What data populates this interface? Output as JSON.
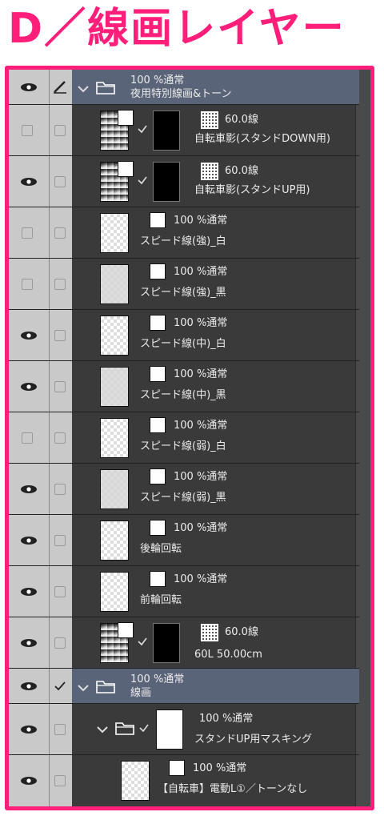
{
  "title": "D／線画レイヤー",
  "layers": [
    {
      "name": "夜用特別線画&トーン",
      "mode": "100 %通常"
    },
    {
      "name": "自転車影(スタンドDOWN用)",
      "mode": "60.0線"
    },
    {
      "name": "自転車影(スタンドUP用)",
      "mode": "60.0線"
    },
    {
      "name": "スピード線(強)_白",
      "mode": "100 %通常"
    },
    {
      "name": "スピード線(強)_黒",
      "mode": "100 %通常"
    },
    {
      "name": "スピード線(中)_白",
      "mode": "100 %通常"
    },
    {
      "name": "スピード線(中)_黒",
      "mode": "100 %通常"
    },
    {
      "name": "スピード線(弱)_白",
      "mode": "100 %通常"
    },
    {
      "name": "スピード線(弱)_黒",
      "mode": "100 %通常"
    },
    {
      "name": "後輪回転",
      "mode": "100 %通常"
    },
    {
      "name": "前輪回転",
      "mode": "100 %通常"
    },
    {
      "name": "60L 50.00cm",
      "mode": "60.0線"
    },
    {
      "name": "線画",
      "mode": "100 %通常"
    },
    {
      "name": "スタンドUP用マスキング",
      "mode": "100 %通常"
    },
    {
      "name": "【自転車】電動L①／トーンなし",
      "mode": "100 %通常"
    }
  ],
  "icons": {
    "visible": "eye-icon",
    "edit": "pen-icon",
    "folder": "folder-icon",
    "expand": "chevron-down-icon",
    "check": "check-icon"
  },
  "colors": {
    "accent": "#ff1e7a",
    "panel": "#3a3a3a",
    "folder_header": "#5a6478"
  }
}
